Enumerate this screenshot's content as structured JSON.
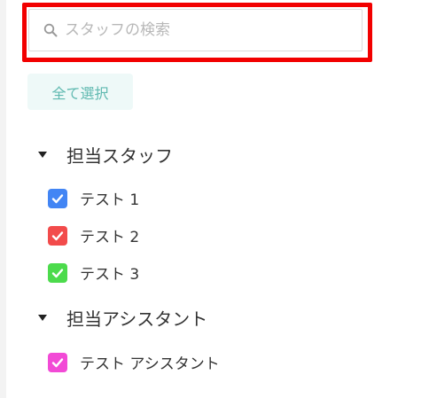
{
  "search": {
    "placeholder": "スタッフの検索",
    "value": "",
    "icon": "search-icon"
  },
  "select_all": {
    "label": "全て選択",
    "bg": "#eef9f8",
    "color": "#5fb9b0"
  },
  "groups": [
    {
      "label": "担当スタッフ",
      "expanded": true,
      "members": [
        {
          "label": "テスト 1",
          "checked": true,
          "color": "#4285f4"
        },
        {
          "label": "テスト 2",
          "checked": true,
          "color": "#f24b4b"
        },
        {
          "label": "テスト 3",
          "checked": true,
          "color": "#4cdb4c"
        }
      ]
    },
    {
      "label": "担当アシスタント",
      "expanded": true,
      "members": [
        {
          "label": "テスト アシスタント",
          "checked": true,
          "color": "#f24ad6"
        }
      ]
    }
  ],
  "colors": {
    "highlight": "#f20000"
  }
}
